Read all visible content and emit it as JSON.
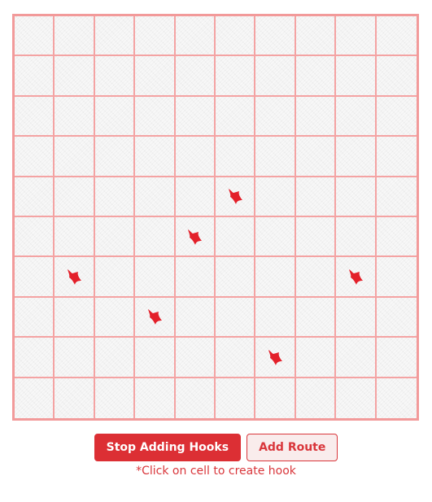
{
  "board": {
    "rows": 10,
    "cols": 10,
    "hook_color": "#e3202a",
    "grid_line_color": "#f4a3a3",
    "hooks": [
      {
        "row": 4,
        "col": 5
      },
      {
        "row": 5,
        "col": 4
      },
      {
        "row": 6,
        "col": 1
      },
      {
        "row": 6,
        "col": 8
      },
      {
        "row": 7,
        "col": 3
      },
      {
        "row": 8,
        "col": 6
      }
    ]
  },
  "controls": {
    "stop_label": "Stop Adding Hooks",
    "add_route_label": "Add Route",
    "hint": "*Click on cell to create hook"
  },
  "colors": {
    "primary": "#dc2f34",
    "accent_text": "#d9363b"
  }
}
